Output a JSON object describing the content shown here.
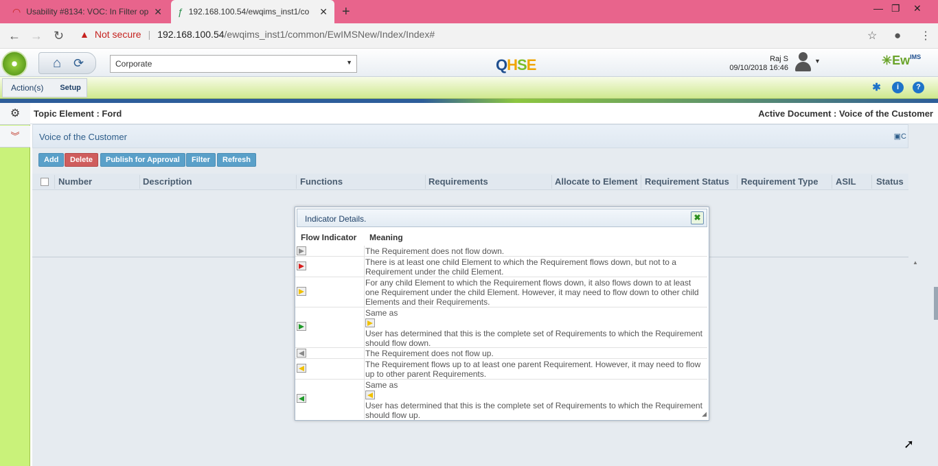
{
  "browser": {
    "tabs": [
      {
        "title": "Usability #8134: VOC: In Filter op",
        "active": false
      },
      {
        "title": "192.168.100.54/ewqims_inst1/co",
        "active": true
      }
    ],
    "security": "Not secure",
    "url_host": "192.168.100.54",
    "url_path": "/ewqims_inst1/common/EwIMSNew/Index/Index#"
  },
  "header": {
    "org_select": "Corporate",
    "qhse_logo": "QHSE",
    "user_name": "Raj S",
    "datetime": "09/10/2018 16:46",
    "brand": "EwQIMS"
  },
  "menu": {
    "actions": "Action(s)",
    "setup": "Setup"
  },
  "topic": {
    "element": "Topic Element : Ford",
    "active_document": "Active Document : Voice of the Customer"
  },
  "panel": {
    "title": "Voice of the Customer",
    "broken_image_text": "C"
  },
  "toolbar": {
    "add": "Add",
    "delete": "Delete",
    "publish": "Publish for Approval",
    "filter": "Filter",
    "refresh": "Refresh"
  },
  "grid": {
    "columns": [
      "Number",
      "Description",
      "Functions",
      "Requirements",
      "Allocate to Element",
      "Requirement Status",
      "Requirement Type",
      "ASIL",
      "Status"
    ]
  },
  "dialog": {
    "title": "Indicator Details.",
    "col_indicator": "Flow Indicator",
    "col_meaning": "Meaning",
    "rows": [
      {
        "meaning": "The Requirement does not flow down."
      },
      {
        "meaning": "There is at least one child Element to which the Requirement flows down, but not to a Requirement under the child Element."
      },
      {
        "meaning": "For any child Element to which the Requirement flows down, it also flows down to at least one Requirement under the child Element. However, it may need to flow down to other child Elements and their Requirements."
      },
      {
        "same_as": "Same as",
        "meaning": "User has determined that this is the complete set of Requirements to which the Requirement should flow down."
      },
      {
        "meaning": "The Requirement does not flow up."
      },
      {
        "meaning": "The Requirement flows up to at least one parent Requirement. However, it may need to flow up to other parent Requirements."
      },
      {
        "same_as": "Same as",
        "meaning": "User has determined that this is the complete set of Requirements to which the Requirement should flow up."
      }
    ]
  },
  "colors": {
    "flag_grey": "#8a8a8a",
    "flag_red": "#d81e1e",
    "flag_yellow": "#f0c000",
    "flag_green": "#1f9a2a"
  }
}
